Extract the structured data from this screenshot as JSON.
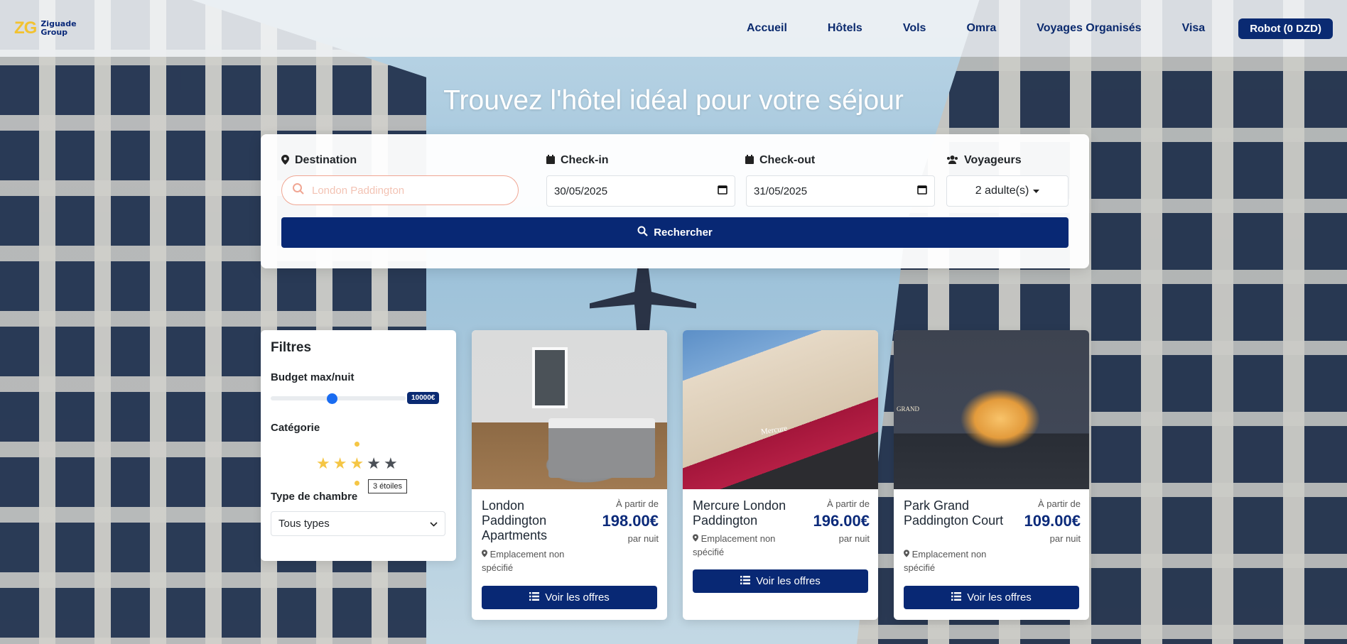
{
  "header": {
    "logo_mark": "ZG",
    "logo_line1": "Ziguade",
    "logo_line2": "Group",
    "nav": [
      "Accueil",
      "Hôtels",
      "Vols",
      "Omra",
      "Voyages Organisés",
      "Visa"
    ],
    "account_label": "Robot (0 DZD)"
  },
  "hero": {
    "title": "Trouvez l'hôtel idéal pour votre séjour"
  },
  "search": {
    "destination_label": "Destination",
    "destination_placeholder": "London Paddington",
    "checkin_label": "Check-in",
    "checkin_value": "30/05/2025",
    "checkout_label": "Check-out",
    "checkout_value": "31/05/2025",
    "travellers_label": "Voyageurs",
    "travellers_value": "2 adulte(s)",
    "search_button": "Rechercher"
  },
  "filters": {
    "title": "Filtres",
    "budget_label": "Budget max/nuit",
    "budget_value": "10000€",
    "budget_slider_fraction": 0.45,
    "category_label": "Catégorie",
    "stars_selected": 3,
    "stars_total": 5,
    "stars_tooltip": "3 étoiles",
    "room_type_label": "Type de chambre",
    "room_type_value": "Tous types"
  },
  "hotels": [
    {
      "name": "London Paddington Apartments",
      "location": "Emplacement non spécifié",
      "price_from": "À partir de",
      "price": "198.00€",
      "per_night": "par nuit",
      "button": "Voir les offres"
    },
    {
      "name": "Mercure London Paddington",
      "location": "Emplacement non spécifié",
      "price_from": "À partir de",
      "price": "196.00€",
      "per_night": "par nuit",
      "button": "Voir les offres"
    },
    {
      "name": "Park Grand Paddington Court",
      "location": "Emplacement non spécifié",
      "price_from": "À partir de",
      "price": "109.00€",
      "per_night": "par nuit",
      "button": "Voir les offres"
    }
  ],
  "colors": {
    "primary": "#082874",
    "logo_yellow": "#f2c230",
    "star_active": "#f5c645",
    "star_inactive": "#4a4f56",
    "slider_thumb": "#1a6cf1"
  }
}
